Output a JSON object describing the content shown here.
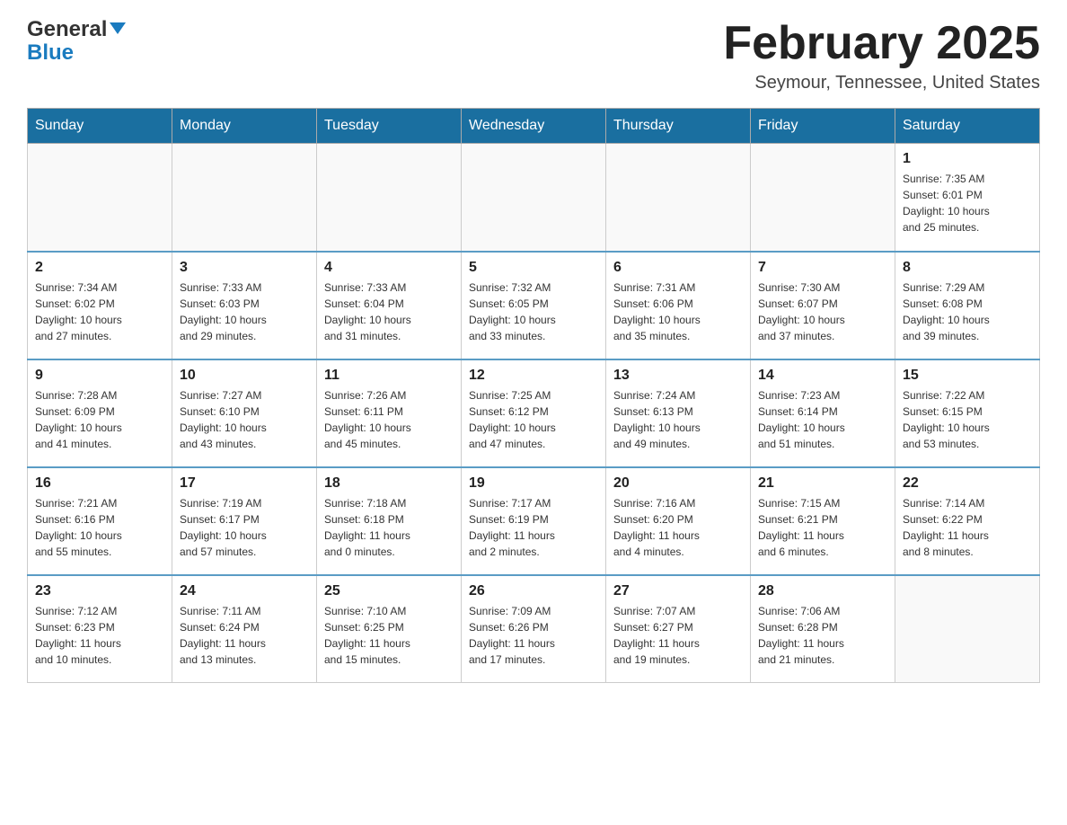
{
  "header": {
    "logo_line1": "General",
    "logo_line2": "Blue",
    "month_title": "February 2025",
    "location": "Seymour, Tennessee, United States"
  },
  "days_of_week": [
    "Sunday",
    "Monday",
    "Tuesday",
    "Wednesday",
    "Thursday",
    "Friday",
    "Saturday"
  ],
  "weeks": [
    [
      {
        "day": "",
        "info": ""
      },
      {
        "day": "",
        "info": ""
      },
      {
        "day": "",
        "info": ""
      },
      {
        "day": "",
        "info": ""
      },
      {
        "day": "",
        "info": ""
      },
      {
        "day": "",
        "info": ""
      },
      {
        "day": "1",
        "info": "Sunrise: 7:35 AM\nSunset: 6:01 PM\nDaylight: 10 hours\nand 25 minutes."
      }
    ],
    [
      {
        "day": "2",
        "info": "Sunrise: 7:34 AM\nSunset: 6:02 PM\nDaylight: 10 hours\nand 27 minutes."
      },
      {
        "day": "3",
        "info": "Sunrise: 7:33 AM\nSunset: 6:03 PM\nDaylight: 10 hours\nand 29 minutes."
      },
      {
        "day": "4",
        "info": "Sunrise: 7:33 AM\nSunset: 6:04 PM\nDaylight: 10 hours\nand 31 minutes."
      },
      {
        "day": "5",
        "info": "Sunrise: 7:32 AM\nSunset: 6:05 PM\nDaylight: 10 hours\nand 33 minutes."
      },
      {
        "day": "6",
        "info": "Sunrise: 7:31 AM\nSunset: 6:06 PM\nDaylight: 10 hours\nand 35 minutes."
      },
      {
        "day": "7",
        "info": "Sunrise: 7:30 AM\nSunset: 6:07 PM\nDaylight: 10 hours\nand 37 minutes."
      },
      {
        "day": "8",
        "info": "Sunrise: 7:29 AM\nSunset: 6:08 PM\nDaylight: 10 hours\nand 39 minutes."
      }
    ],
    [
      {
        "day": "9",
        "info": "Sunrise: 7:28 AM\nSunset: 6:09 PM\nDaylight: 10 hours\nand 41 minutes."
      },
      {
        "day": "10",
        "info": "Sunrise: 7:27 AM\nSunset: 6:10 PM\nDaylight: 10 hours\nand 43 minutes."
      },
      {
        "day": "11",
        "info": "Sunrise: 7:26 AM\nSunset: 6:11 PM\nDaylight: 10 hours\nand 45 minutes."
      },
      {
        "day": "12",
        "info": "Sunrise: 7:25 AM\nSunset: 6:12 PM\nDaylight: 10 hours\nand 47 minutes."
      },
      {
        "day": "13",
        "info": "Sunrise: 7:24 AM\nSunset: 6:13 PM\nDaylight: 10 hours\nand 49 minutes."
      },
      {
        "day": "14",
        "info": "Sunrise: 7:23 AM\nSunset: 6:14 PM\nDaylight: 10 hours\nand 51 minutes."
      },
      {
        "day": "15",
        "info": "Sunrise: 7:22 AM\nSunset: 6:15 PM\nDaylight: 10 hours\nand 53 minutes."
      }
    ],
    [
      {
        "day": "16",
        "info": "Sunrise: 7:21 AM\nSunset: 6:16 PM\nDaylight: 10 hours\nand 55 minutes."
      },
      {
        "day": "17",
        "info": "Sunrise: 7:19 AM\nSunset: 6:17 PM\nDaylight: 10 hours\nand 57 minutes."
      },
      {
        "day": "18",
        "info": "Sunrise: 7:18 AM\nSunset: 6:18 PM\nDaylight: 11 hours\nand 0 minutes."
      },
      {
        "day": "19",
        "info": "Sunrise: 7:17 AM\nSunset: 6:19 PM\nDaylight: 11 hours\nand 2 minutes."
      },
      {
        "day": "20",
        "info": "Sunrise: 7:16 AM\nSunset: 6:20 PM\nDaylight: 11 hours\nand 4 minutes."
      },
      {
        "day": "21",
        "info": "Sunrise: 7:15 AM\nSunset: 6:21 PM\nDaylight: 11 hours\nand 6 minutes."
      },
      {
        "day": "22",
        "info": "Sunrise: 7:14 AM\nSunset: 6:22 PM\nDaylight: 11 hours\nand 8 minutes."
      }
    ],
    [
      {
        "day": "23",
        "info": "Sunrise: 7:12 AM\nSunset: 6:23 PM\nDaylight: 11 hours\nand 10 minutes."
      },
      {
        "day": "24",
        "info": "Sunrise: 7:11 AM\nSunset: 6:24 PM\nDaylight: 11 hours\nand 13 minutes."
      },
      {
        "day": "25",
        "info": "Sunrise: 7:10 AM\nSunset: 6:25 PM\nDaylight: 11 hours\nand 15 minutes."
      },
      {
        "day": "26",
        "info": "Sunrise: 7:09 AM\nSunset: 6:26 PM\nDaylight: 11 hours\nand 17 minutes."
      },
      {
        "day": "27",
        "info": "Sunrise: 7:07 AM\nSunset: 6:27 PM\nDaylight: 11 hours\nand 19 minutes."
      },
      {
        "day": "28",
        "info": "Sunrise: 7:06 AM\nSunset: 6:28 PM\nDaylight: 11 hours\nand 21 minutes."
      },
      {
        "day": "",
        "info": ""
      }
    ]
  ]
}
